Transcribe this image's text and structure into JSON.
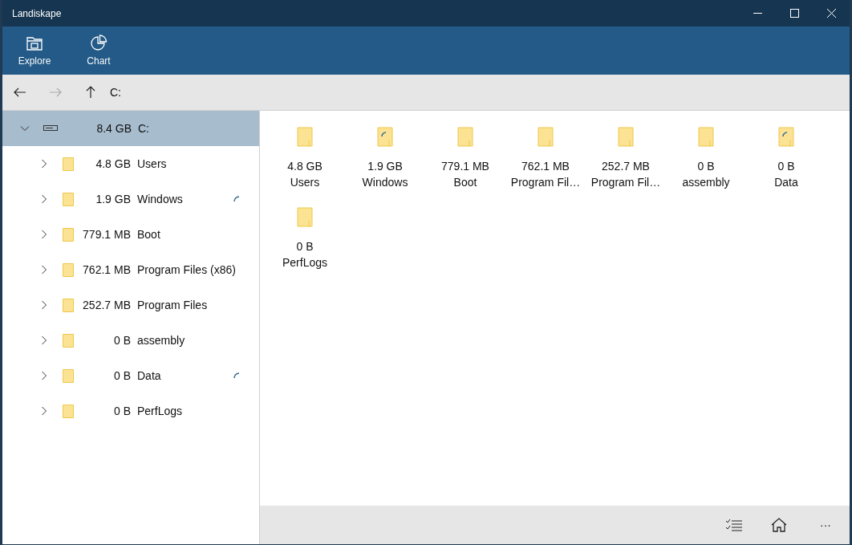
{
  "window": {
    "title": "Landiskape"
  },
  "ribbon": [
    {
      "label": "Explore",
      "kind": "explore"
    },
    {
      "label": "Chart",
      "kind": "chart"
    }
  ],
  "nav": {
    "path": "C:",
    "back_disabled": false,
    "forward_disabled": true
  },
  "tree": [
    {
      "size": "8.4 GB",
      "name": "C:",
      "kind": "drive",
      "expanded": true,
      "selected": true,
      "loading": false,
      "children": [
        {
          "size": "4.8 GB",
          "name": "Users",
          "kind": "folder",
          "expanded": false,
          "selected": false,
          "loading": false
        },
        {
          "size": "1.9 GB",
          "name": "Windows",
          "kind": "folder",
          "expanded": false,
          "selected": false,
          "loading": true
        },
        {
          "size": "779.1 MB",
          "name": "Boot",
          "kind": "folder",
          "expanded": false,
          "selected": false,
          "loading": false
        },
        {
          "size": "762.1 MB",
          "name": "Program Files (x86)",
          "kind": "folder",
          "expanded": false,
          "selected": false,
          "loading": false
        },
        {
          "size": "252.7 MB",
          "name": "Program Files",
          "kind": "folder",
          "expanded": false,
          "selected": false,
          "loading": false
        },
        {
          "size": "0 B",
          "name": "assembly",
          "kind": "folder",
          "expanded": false,
          "selected": false,
          "loading": false
        },
        {
          "size": "0 B",
          "name": "Data",
          "kind": "folder",
          "expanded": false,
          "selected": false,
          "loading": true
        },
        {
          "size": "0 B",
          "name": "PerfLogs",
          "kind": "folder",
          "expanded": false,
          "selected": false,
          "loading": false
        }
      ]
    }
  ],
  "tiles": [
    {
      "size": "4.8 GB",
      "name": "Users",
      "loading": false
    },
    {
      "size": "1.9 GB",
      "name": "Windows",
      "loading": true
    },
    {
      "size": "779.1 MB",
      "name": "Boot",
      "loading": false
    },
    {
      "size": "762.1 MB",
      "name": "Program Fil…",
      "loading": false
    },
    {
      "size": "252.7 MB",
      "name": "Program Fil…",
      "loading": false
    },
    {
      "size": "0 B",
      "name": "assembly",
      "loading": false
    },
    {
      "size": "0 B",
      "name": "Data",
      "loading": true
    },
    {
      "size": "0 B",
      "name": "PerfLogs",
      "loading": false
    }
  ],
  "bottom_bar": {
    "more": "···"
  }
}
